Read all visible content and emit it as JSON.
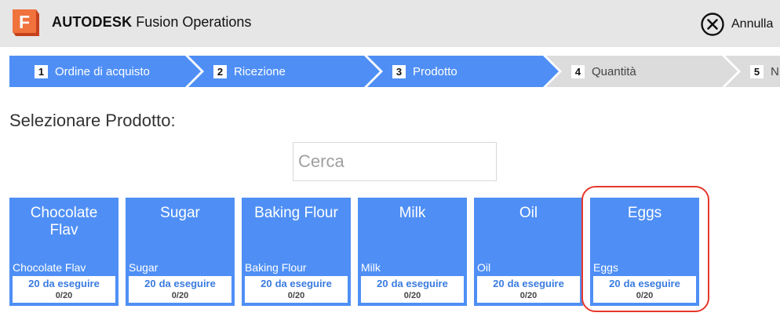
{
  "app": {
    "brand_bold": "AUTODESK",
    "brand_rest": "Fusion Operations",
    "logo_letter": "F",
    "logo_colors": [
      "#f0723c",
      "#c7411d"
    ],
    "cancel_label": "Annulla",
    "cancel_icon": "close-circle-icon"
  },
  "steps": [
    {
      "num": "1",
      "label": "Ordine di acquisto",
      "state": "active"
    },
    {
      "num": "2",
      "label": "Ricezione",
      "state": "active"
    },
    {
      "num": "3",
      "label": "Prodotto",
      "state": "active"
    },
    {
      "num": "4",
      "label": "Quantità",
      "state": "inactive"
    },
    {
      "num": "5",
      "label": "N",
      "state": "inactive"
    }
  ],
  "colors": {
    "accent": "#4f8ff5",
    "step_inactive": "#dcdcdc",
    "highlight": "#e8372c"
  },
  "page_title": "Selezionare Prodotto:",
  "search": {
    "placeholder": "Cerca",
    "value": ""
  },
  "products": [
    {
      "title": "Chocolate Flav",
      "subtitle": "Chocolate Flav",
      "count": "20",
      "todo_label": "da eseguire",
      "progress": "0/20"
    },
    {
      "title": "Sugar",
      "subtitle": "Sugar",
      "count": "20",
      "todo_label": "da eseguire",
      "progress": "0/20"
    },
    {
      "title": "Baking Flour",
      "subtitle": "Baking Flour",
      "count": "20",
      "todo_label": "da eseguire",
      "progress": "0/20"
    },
    {
      "title": "Milk",
      "subtitle": "Milk",
      "count": "20",
      "todo_label": "da eseguire",
      "progress": "0/20"
    },
    {
      "title": "Oil",
      "subtitle": "Oil",
      "count": "20",
      "todo_label": "da eseguire",
      "progress": "0/20"
    },
    {
      "title": "Eggs",
      "subtitle": "Eggs",
      "count": "20",
      "todo_label": "da eseguire",
      "progress": "0/20",
      "highlighted": true
    }
  ]
}
